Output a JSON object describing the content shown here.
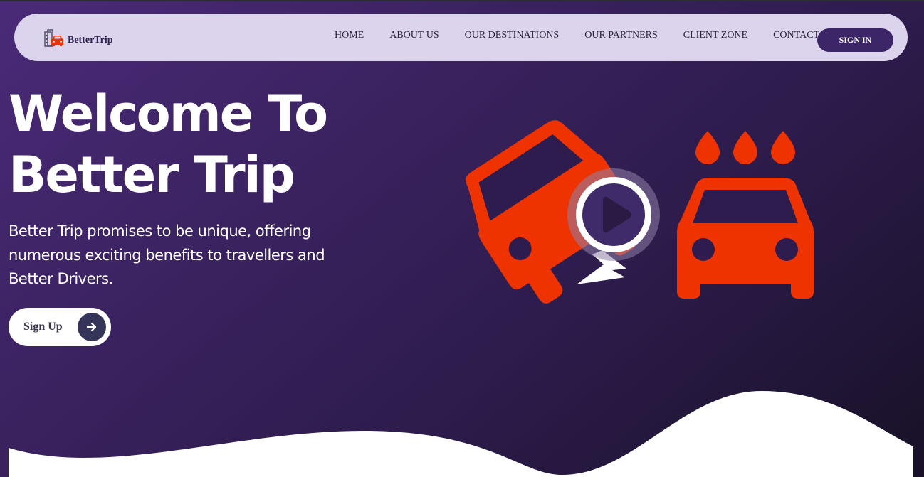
{
  "brand": {
    "name": "BetterTrip",
    "icon": "city-car-icon"
  },
  "nav": {
    "items": [
      {
        "label": "HOME"
      },
      {
        "label": "ABOUT US"
      },
      {
        "label": "OUR DESTINATIONS"
      },
      {
        "label": "OUR PARTNERS"
      },
      {
        "label": "CLIENT ZONE"
      },
      {
        "label": "CONTACT"
      }
    ],
    "signin_label": "SIGN IN"
  },
  "hero": {
    "title_line1": "Welcome To",
    "title_line2": "Better Trip",
    "subtitle": "Better Trip promises to be unique, offering numerous exciting benefits to travellers and Better Drivers.",
    "signup_label": "Sign Up",
    "signup_icon": "arrow-right-icon"
  },
  "illustration": {
    "left_icon": "car-crash-icon",
    "right_icon": "car-wash-icon",
    "center_icon": "play-icon"
  },
  "colors": {
    "accent": "#ee3300",
    "nav_bg": "#dcd4ec",
    "button_dark": "#3c2668",
    "background_start": "#4a2a78",
    "background_end": "#181127",
    "wave": "#ffffff"
  }
}
